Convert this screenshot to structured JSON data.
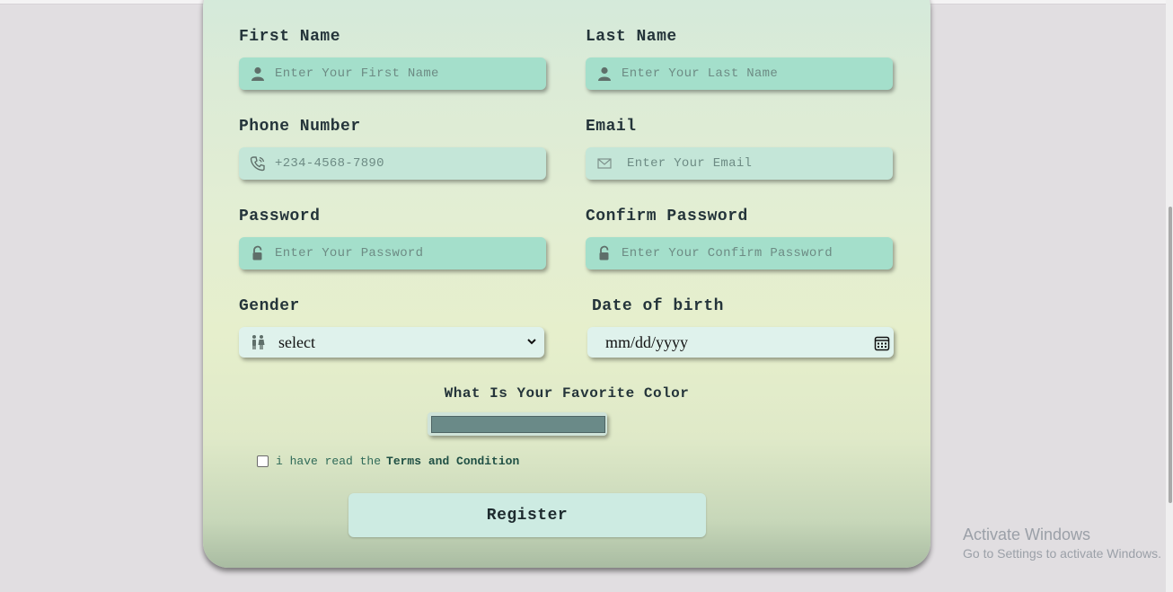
{
  "form": {
    "first_name": {
      "label": "First Name",
      "placeholder": "Enter Your First Name"
    },
    "last_name": {
      "label": "Last Name",
      "placeholder": "Enter Your Last Name"
    },
    "phone": {
      "label": "Phone Number",
      "placeholder": "+234-4568-7890"
    },
    "email": {
      "label": "Email",
      "placeholder": "Enter Your Email"
    },
    "password": {
      "label": "Password",
      "placeholder": "Enter Your Password"
    },
    "confirm_password": {
      "label": "Confirm Password",
      "placeholder": "Enter Your Confirm Password"
    },
    "gender": {
      "label": "Gender",
      "selected": "select"
    },
    "dob": {
      "label": "Date of birth",
      "value": "mm/dd/yyyy"
    },
    "favorite_color": {
      "label": "What Is Your Favorite Color",
      "value": "#6a8a88"
    },
    "terms": {
      "text": "i have read the",
      "link": "Terms and Condition"
    },
    "register_label": "Register"
  },
  "icons": {
    "user": "user-icon",
    "phone": "phone-icon",
    "email": "envelope-icon",
    "lock": "lock-icon",
    "gender": "people-icon",
    "calendar": "calendar-icon"
  },
  "watermark": {
    "title": "Activate Windows",
    "subtitle": "Go to Settings to activate Windows."
  }
}
